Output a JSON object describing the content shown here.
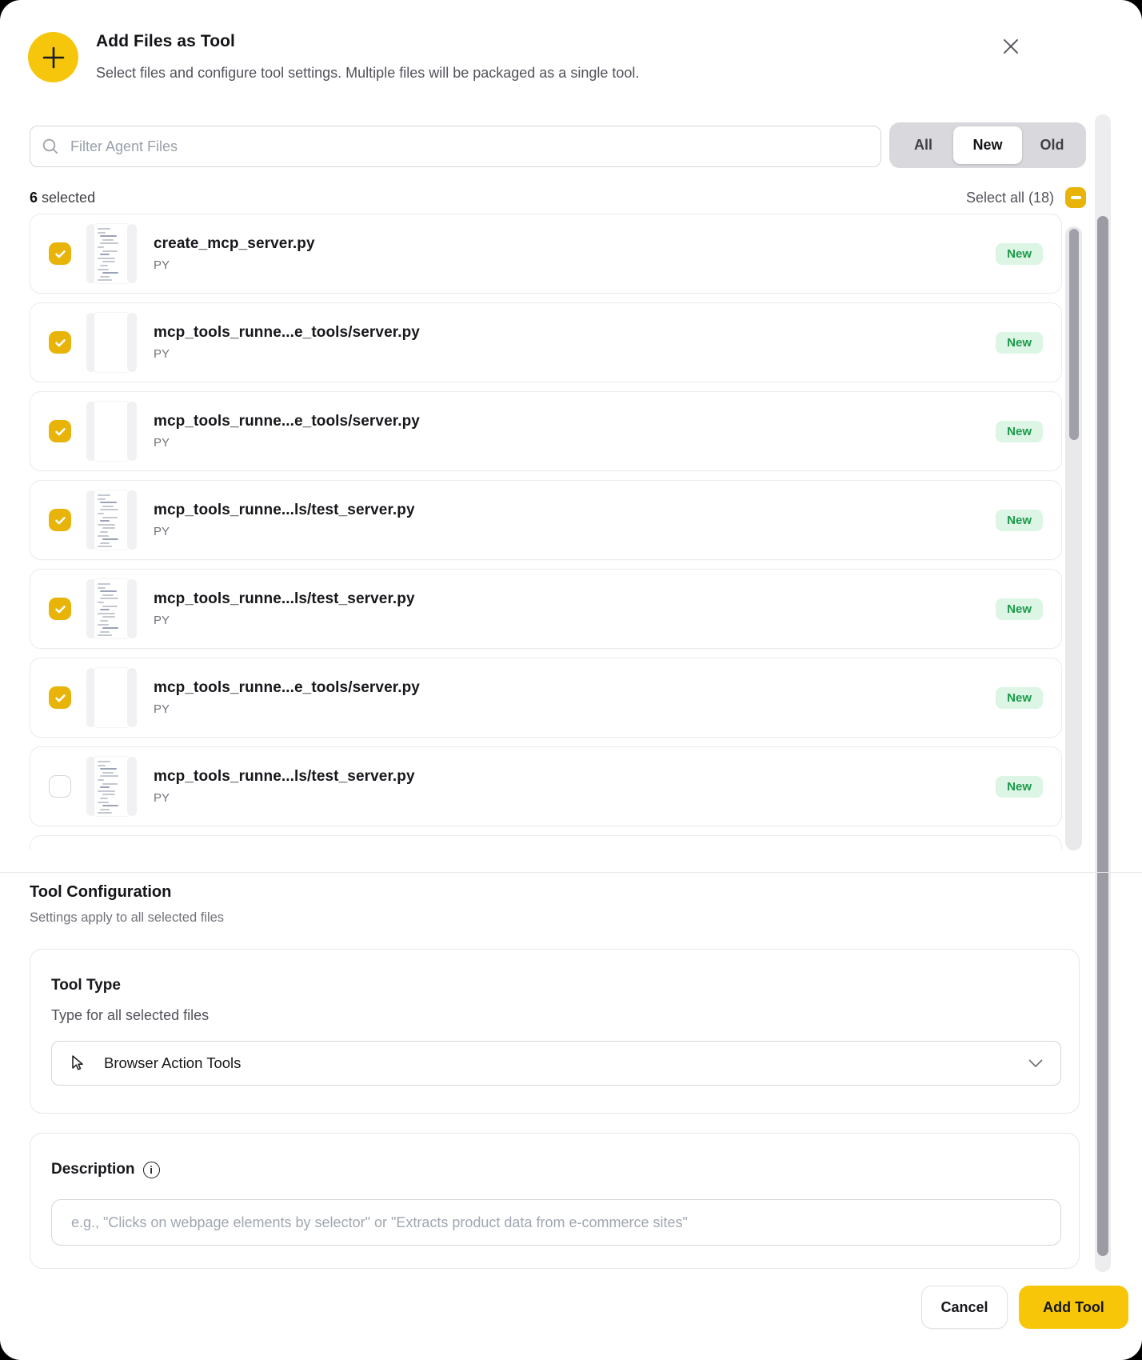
{
  "colors": {
    "accent": "#F5C60B",
    "accent_button": "#F7C608",
    "checkbox": "#E9B40A",
    "badge_bg": "#DCF5E4",
    "badge_text": "#1B9A4B"
  },
  "header": {
    "icon": "plus-icon",
    "title": "Add Files as Tool",
    "subtitle": "Select files and configure tool settings. Multiple files will be packaged as a single tool.",
    "close_icon": "close-icon"
  },
  "filter": {
    "placeholder": "Filter Agent Files",
    "tabs": [
      "All",
      "New",
      "Old"
    ],
    "active_tab": "New"
  },
  "selection": {
    "count": "6",
    "count_label": "selected",
    "select_all_label": "Select all (18)",
    "select_all_state": "indeterminate"
  },
  "files": [
    {
      "name": "create_mcp_server.py",
      "type": "PY",
      "badge": "New",
      "checked": true,
      "thumb": "code"
    },
    {
      "name": "mcp_tools_runne...e_tools/server.py",
      "type": "PY",
      "badge": "New",
      "checked": true,
      "thumb": "blank"
    },
    {
      "name": "mcp_tools_runne...e_tools/server.py",
      "type": "PY",
      "badge": "New",
      "checked": true,
      "thumb": "blank"
    },
    {
      "name": "mcp_tools_runne...ls/test_server.py",
      "type": "PY",
      "badge": "New",
      "checked": true,
      "thumb": "code"
    },
    {
      "name": "mcp_tools_runne...ls/test_server.py",
      "type": "PY",
      "badge": "New",
      "checked": true,
      "thumb": "code"
    },
    {
      "name": "mcp_tools_runne...e_tools/server.py",
      "type": "PY",
      "badge": "New",
      "checked": true,
      "thumb": "blank"
    },
    {
      "name": "mcp_tools_runne...ls/test_server.py",
      "type": "PY",
      "badge": "New",
      "checked": false,
      "thumb": "code"
    }
  ],
  "list": {
    "partial_row_visible": true
  },
  "config": {
    "heading": "Tool Configuration",
    "subheading": "Settings apply to all selected files",
    "tool_type": {
      "label": "Tool Type",
      "sublabel": "Type for all selected files",
      "value": "Browser Action Tools"
    },
    "description": {
      "label": "Description",
      "info_icon": "info-icon",
      "placeholder": "e.g., \"Clicks on webpage elements by selector\" or \"Extracts product data from e-commerce sites\""
    }
  },
  "footer": {
    "cancel_label": "Cancel",
    "add_label": "Add Tool"
  }
}
